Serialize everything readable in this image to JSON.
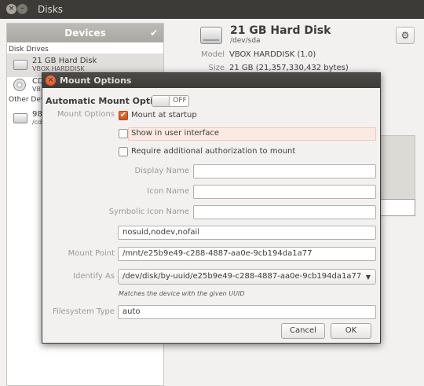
{
  "window": {
    "title": "Disks",
    "close_glyph": "×",
    "min_glyph": "–"
  },
  "sidebar": {
    "header": "Devices",
    "header_check": "✔",
    "section_drives": "Disk Drives",
    "section_other": "Other Devi",
    "items": [
      {
        "name": "21 GB Hard Disk",
        "sub": "VBOX HARDDISK",
        "icon": "hard-disk-icon"
      },
      {
        "name": "CD",
        "sub": "VB",
        "icon": "optical-disc-icon"
      },
      {
        "name": "98",
        "sub": "/cd",
        "icon": "hard-disk-icon"
      }
    ]
  },
  "drive": {
    "title": "21 GB Hard Disk",
    "path": "/dev/sda",
    "gear_glyph": "⚙",
    "model_label": "Model",
    "model_value": "VBOX HARDDISK (1.0)",
    "size_label": "Size",
    "size_value": "21 GB (21,357,330,432 bytes)"
  },
  "dialog": {
    "title": "Mount Options",
    "close_glyph": "×",
    "auto_label": "Automatic Mount Options",
    "toggle_state": "OFF",
    "mount_options_label": "Mount Options",
    "checkboxes": [
      {
        "label": "Mount at startup",
        "checked": true,
        "mark": "✔"
      },
      {
        "label": "Show in user interface",
        "checked": false
      },
      {
        "label": "Require additional authorization to mount",
        "checked": false
      }
    ],
    "display_name_label": "Display Name",
    "display_name_value": "",
    "icon_name_label": "Icon Name",
    "icon_name_value": "",
    "symbolic_icon_label": "Symbolic Icon Name",
    "symbolic_icon_value": "",
    "options_value": "nosuid,nodev,nofail",
    "mount_point_label": "Mount Point",
    "mount_point_value": "/mnt/e25b9e49-c288-4887-aa0e-9cb194da1a77",
    "identify_as_label": "Identify As",
    "identify_as_value": "/dev/disk/by-uuid/e25b9e49-c288-4887-aa0e-9cb194da1a77",
    "identify_arrow": "▼",
    "hint": "Matches the device with the given UUID",
    "fs_type_label": "Filesystem Type",
    "fs_type_value": "auto",
    "cancel_label": "Cancel",
    "ok_label": "OK"
  },
  "colors": {
    "accent": "#dd4814",
    "titlebar": "#3c3b37",
    "window_bg": "#f2f1f0"
  }
}
